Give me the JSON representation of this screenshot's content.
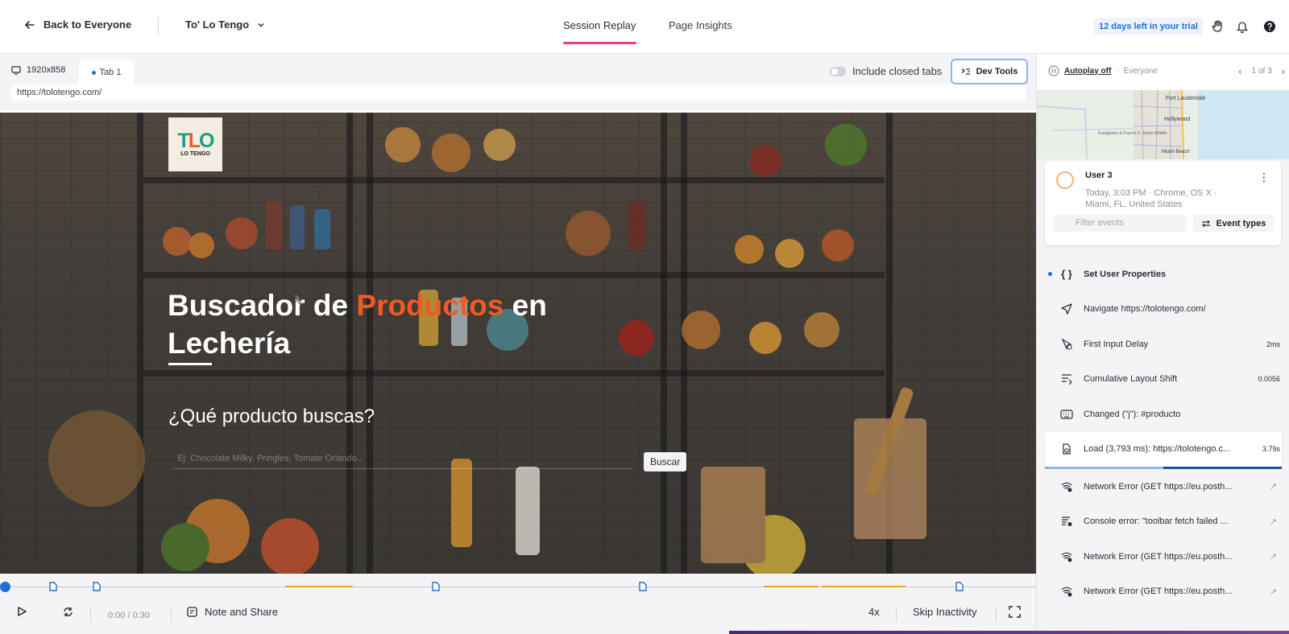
{
  "topbar": {
    "back_label": "Back to Everyone",
    "project_name": "To' Lo Tengo",
    "tabs": [
      {
        "label": "Session Replay",
        "active": true
      },
      {
        "label": "Page Insights",
        "active": false
      }
    ],
    "trial_badge": "12 days left in your trial"
  },
  "player": {
    "resolution": "1920x858",
    "tab_label": "Tab 1",
    "url": "https://tolotengo.com/",
    "include_closed_tabs_label": "Include closed tabs",
    "devtools_label": "Dev Tools"
  },
  "site": {
    "logo_mark": "TLO",
    "logo_sub": "LO TENGO",
    "title_part1": "Buscador de ",
    "title_accent": "Productos",
    "title_part2": " en Lechería",
    "subtitle": "¿Qué producto buscas?",
    "search_placeholder": "Ej: Chocolate Milky, Pringles, Tomate Orlando...",
    "search_button": "Buscar"
  },
  "controls": {
    "time": "0:00 / 0:30",
    "note_label": "Note and Share",
    "speed": "4x",
    "skip_label": "Skip Inactivity"
  },
  "side": {
    "autoplay_label": "Autoplay off",
    "autoplay_scope": "Everyone",
    "pager_text": "1 of 3",
    "map_labels": [
      "Fort Lauderdale",
      "Hollywood",
      "Everglades & Francis S. Taylor Wildlife",
      "Miami Beach"
    ],
    "user": {
      "name": "User 3",
      "meta_line1": "Today, 3:03 PM · Chrome, OS X ·",
      "meta_line2": "Miami, FL, United States"
    },
    "filter_placeholder": "Filter events",
    "event_types_label": "Event types",
    "events": [
      {
        "icon": "braces-icon",
        "text": "Set User Properties",
        "value": "",
        "bold": true,
        "dot": true
      },
      {
        "icon": "navigate-icon",
        "text": "Navigate https://tolotengo.com/",
        "value": ""
      },
      {
        "icon": "input-delay-icon",
        "text": "First Input Delay",
        "value": "2ms"
      },
      {
        "icon": "layout-shift-icon",
        "text": "Cumulative Layout Shift",
        "value": "0.0056"
      },
      {
        "icon": "keyboard-icon",
        "text": "Changed (\"j\"): #producto",
        "value": ""
      },
      {
        "icon": "load-icon",
        "text": "Load (3,793 ms): https://tolotengo.c...",
        "value": "3.79s",
        "active": true
      },
      {
        "icon": "network-error-icon",
        "text": "Network Error (GET https://eu.posth...",
        "value": "",
        "arrow": true
      },
      {
        "icon": "console-error-icon",
        "text": "Console error: \"toolbar fetch failed ...",
        "value": "",
        "arrow": true
      },
      {
        "icon": "network-error-icon",
        "text": "Network Error (GET https://eu.posth...",
        "value": "",
        "arrow": true
      },
      {
        "icon": "network-error-icon",
        "text": "Network Error (GET https://eu.posth...",
        "value": "",
        "arrow": true
      }
    ],
    "load_progress": 0.5
  }
}
